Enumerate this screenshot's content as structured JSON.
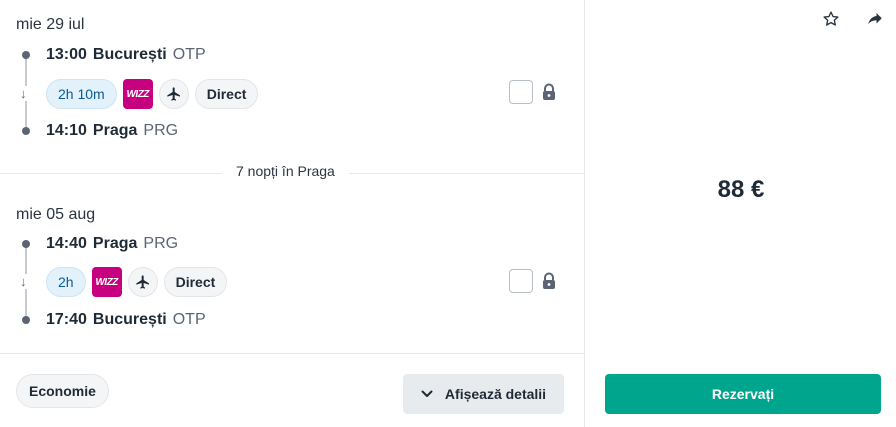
{
  "outbound": {
    "date": "mie 29 iul",
    "depart": {
      "time": "13:00",
      "city": "București",
      "code": "OTP"
    },
    "duration": "2h 10m",
    "airline_logo": "WIZZ",
    "stops": "Direct",
    "arrive": {
      "time": "14:10",
      "city": "Praga",
      "code": "PRG"
    }
  },
  "stay": {
    "nights_label": "7 nopți în Praga"
  },
  "inbound": {
    "date": "mie 05 aug",
    "depart": {
      "time": "14:40",
      "city": "Praga",
      "code": "PRG"
    },
    "duration": "2h",
    "airline_logo": "WIZZ",
    "stops": "Direct",
    "arrive": {
      "time": "17:40",
      "city": "București",
      "code": "OTP"
    }
  },
  "footer": {
    "cabin_class": "Economie",
    "details_label": "Afișează detalii"
  },
  "booking": {
    "price": "88 €",
    "book_label": "Rezervați"
  },
  "colors": {
    "accent": "#00a58e",
    "airline": "#c6007e",
    "duration_chip": "#e3f1fb"
  },
  "icons": [
    "star-icon",
    "share-icon",
    "plane-icon",
    "lock-icon",
    "chevron-down-icon",
    "arrow-down-icon"
  ]
}
